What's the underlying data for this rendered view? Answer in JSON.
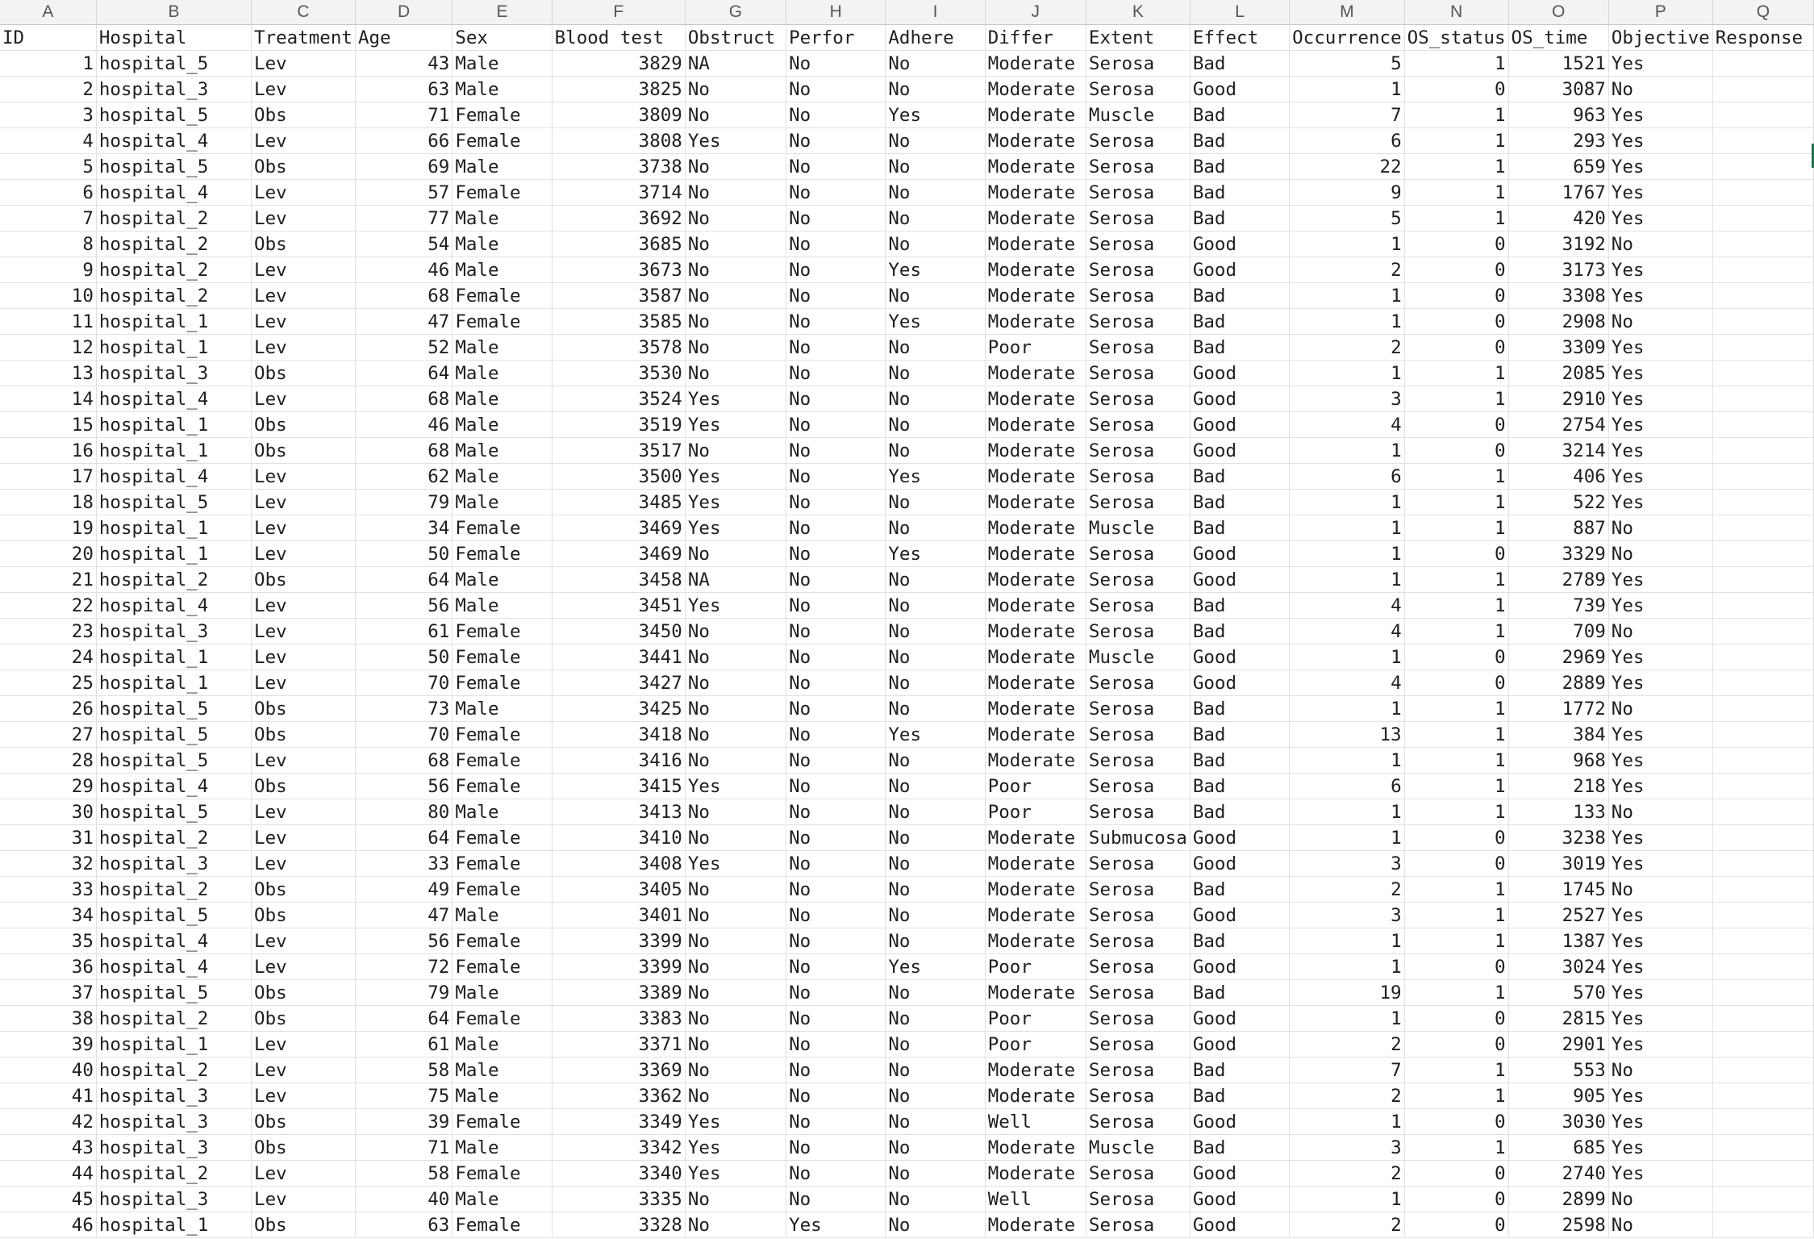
{
  "column_letters": [
    "A",
    "B",
    "C",
    "D",
    "E",
    "F",
    "G",
    "H",
    "I",
    "J",
    "K",
    "L",
    "M",
    "N",
    "O",
    "P",
    "Q"
  ],
  "header_row": [
    "ID",
    "Hospital",
    "Treatment",
    "Age",
    "Sex",
    "Blood test",
    "Obstruct",
    "Perfor",
    "Adhere",
    "Differ",
    "Extent",
    "Effect",
    "Occurrence",
    "OS_status",
    "OS_time",
    "Objective",
    "Response"
  ],
  "rows": [
    [
      "1",
      "hospital_5",
      "Lev",
      "43",
      "Male",
      "3829",
      "NA",
      "No",
      "No",
      "Moderate",
      "Serosa",
      "Bad",
      "5",
      "1",
      "1521",
      "Yes",
      ""
    ],
    [
      "2",
      "hospital_3",
      "Lev",
      "63",
      "Male",
      "3825",
      "No",
      "No",
      "No",
      "Moderate",
      "Serosa",
      "Good",
      "1",
      "0",
      "3087",
      "No",
      ""
    ],
    [
      "3",
      "hospital_5",
      "Obs",
      "71",
      "Female",
      "3809",
      "No",
      "No",
      "Yes",
      "Moderate",
      "Muscle",
      "Bad",
      "7",
      "1",
      "963",
      "Yes",
      ""
    ],
    [
      "4",
      "hospital_4",
      "Lev",
      "66",
      "Female",
      "3808",
      "Yes",
      "No",
      "No",
      "Moderate",
      "Serosa",
      "Bad",
      "6",
      "1",
      "293",
      "Yes",
      ""
    ],
    [
      "5",
      "hospital_5",
      "Obs",
      "69",
      "Male",
      "3738",
      "No",
      "No",
      "No",
      "Moderate",
      "Serosa",
      "Bad",
      "22",
      "1",
      "659",
      "Yes",
      ""
    ],
    [
      "6",
      "hospital_4",
      "Lev",
      "57",
      "Female",
      "3714",
      "No",
      "No",
      "No",
      "Moderate",
      "Serosa",
      "Bad",
      "9",
      "1",
      "1767",
      "Yes",
      ""
    ],
    [
      "7",
      "hospital_2",
      "Lev",
      "77",
      "Male",
      "3692",
      "No",
      "No",
      "No",
      "Moderate",
      "Serosa",
      "Bad",
      "5",
      "1",
      "420",
      "Yes",
      ""
    ],
    [
      "8",
      "hospital_2",
      "Obs",
      "54",
      "Male",
      "3685",
      "No",
      "No",
      "No",
      "Moderate",
      "Serosa",
      "Good",
      "1",
      "0",
      "3192",
      "No",
      ""
    ],
    [
      "9",
      "hospital_2",
      "Lev",
      "46",
      "Male",
      "3673",
      "No",
      "No",
      "Yes",
      "Moderate",
      "Serosa",
      "Good",
      "2",
      "0",
      "3173",
      "Yes",
      ""
    ],
    [
      "10",
      "hospital_2",
      "Lev",
      "68",
      "Female",
      "3587",
      "No",
      "No",
      "No",
      "Moderate",
      "Serosa",
      "Bad",
      "1",
      "0",
      "3308",
      "Yes",
      ""
    ],
    [
      "11",
      "hospital_1",
      "Lev",
      "47",
      "Female",
      "3585",
      "No",
      "No",
      "Yes",
      "Moderate",
      "Serosa",
      "Bad",
      "1",
      "0",
      "2908",
      "No",
      ""
    ],
    [
      "12",
      "hospital_1",
      "Lev",
      "52",
      "Male",
      "3578",
      "No",
      "No",
      "No",
      "Poor",
      "Serosa",
      "Bad",
      "2",
      "0",
      "3309",
      "Yes",
      ""
    ],
    [
      "13",
      "hospital_3",
      "Obs",
      "64",
      "Male",
      "3530",
      "No",
      "No",
      "No",
      "Moderate",
      "Serosa",
      "Good",
      "1",
      "1",
      "2085",
      "Yes",
      ""
    ],
    [
      "14",
      "hospital_4",
      "Lev",
      "68",
      "Male",
      "3524",
      "Yes",
      "No",
      "No",
      "Moderate",
      "Serosa",
      "Good",
      "3",
      "1",
      "2910",
      "Yes",
      ""
    ],
    [
      "15",
      "hospital_1",
      "Obs",
      "46",
      "Male",
      "3519",
      "Yes",
      "No",
      "No",
      "Moderate",
      "Serosa",
      "Good",
      "4",
      "0",
      "2754",
      "Yes",
      ""
    ],
    [
      "16",
      "hospital_1",
      "Obs",
      "68",
      "Male",
      "3517",
      "No",
      "No",
      "No",
      "Moderate",
      "Serosa",
      "Good",
      "1",
      "0",
      "3214",
      "Yes",
      ""
    ],
    [
      "17",
      "hospital_4",
      "Lev",
      "62",
      "Male",
      "3500",
      "Yes",
      "No",
      "Yes",
      "Moderate",
      "Serosa",
      "Bad",
      "6",
      "1",
      "406",
      "Yes",
      ""
    ],
    [
      "18",
      "hospital_5",
      "Lev",
      "79",
      "Male",
      "3485",
      "Yes",
      "No",
      "No",
      "Moderate",
      "Serosa",
      "Bad",
      "1",
      "1",
      "522",
      "Yes",
      ""
    ],
    [
      "19",
      "hospital_1",
      "Lev",
      "34",
      "Female",
      "3469",
      "Yes",
      "No",
      "No",
      "Moderate",
      "Muscle",
      "Bad",
      "1",
      "1",
      "887",
      "No",
      ""
    ],
    [
      "20",
      "hospital_1",
      "Lev",
      "50",
      "Female",
      "3469",
      "No",
      "No",
      "Yes",
      "Moderate",
      "Serosa",
      "Good",
      "1",
      "0",
      "3329",
      "No",
      ""
    ],
    [
      "21",
      "hospital_2",
      "Obs",
      "64",
      "Male",
      "3458",
      "NA",
      "No",
      "No",
      "Moderate",
      "Serosa",
      "Good",
      "1",
      "1",
      "2789",
      "Yes",
      ""
    ],
    [
      "22",
      "hospital_4",
      "Lev",
      "56",
      "Male",
      "3451",
      "Yes",
      "No",
      "No",
      "Moderate",
      "Serosa",
      "Bad",
      "4",
      "1",
      "739",
      "Yes",
      ""
    ],
    [
      "23",
      "hospital_3",
      "Lev",
      "61",
      "Female",
      "3450",
      "No",
      "No",
      "No",
      "Moderate",
      "Serosa",
      "Bad",
      "4",
      "1",
      "709",
      "No",
      ""
    ],
    [
      "24",
      "hospital_1",
      "Lev",
      "50",
      "Female",
      "3441",
      "No",
      "No",
      "No",
      "Moderate",
      "Muscle",
      "Good",
      "1",
      "0",
      "2969",
      "Yes",
      ""
    ],
    [
      "25",
      "hospital_1",
      "Lev",
      "70",
      "Female",
      "3427",
      "No",
      "No",
      "No",
      "Moderate",
      "Serosa",
      "Good",
      "4",
      "0",
      "2889",
      "Yes",
      ""
    ],
    [
      "26",
      "hospital_5",
      "Obs",
      "73",
      "Male",
      "3425",
      "No",
      "No",
      "No",
      "Moderate",
      "Serosa",
      "Bad",
      "1",
      "1",
      "1772",
      "No",
      ""
    ],
    [
      "27",
      "hospital_5",
      "Obs",
      "70",
      "Female",
      "3418",
      "No",
      "No",
      "Yes",
      "Moderate",
      "Serosa",
      "Bad",
      "13",
      "1",
      "384",
      "Yes",
      ""
    ],
    [
      "28",
      "hospital_5",
      "Lev",
      "68",
      "Female",
      "3416",
      "No",
      "No",
      "No",
      "Moderate",
      "Serosa",
      "Bad",
      "1",
      "1",
      "968",
      "Yes",
      ""
    ],
    [
      "29",
      "hospital_4",
      "Obs",
      "56",
      "Female",
      "3415",
      "Yes",
      "No",
      "No",
      "Poor",
      "Serosa",
      "Bad",
      "6",
      "1",
      "218",
      "Yes",
      ""
    ],
    [
      "30",
      "hospital_5",
      "Lev",
      "80",
      "Male",
      "3413",
      "No",
      "No",
      "No",
      "Poor",
      "Serosa",
      "Bad",
      "1",
      "1",
      "133",
      "No",
      ""
    ],
    [
      "31",
      "hospital_2",
      "Lev",
      "64",
      "Female",
      "3410",
      "No",
      "No",
      "No",
      "Moderate",
      "Submucosa",
      "Good",
      "1",
      "0",
      "3238",
      "Yes",
      ""
    ],
    [
      "32",
      "hospital_3",
      "Lev",
      "33",
      "Female",
      "3408",
      "Yes",
      "No",
      "No",
      "Moderate",
      "Serosa",
      "Good",
      "3",
      "0",
      "3019",
      "Yes",
      ""
    ],
    [
      "33",
      "hospital_2",
      "Obs",
      "49",
      "Female",
      "3405",
      "No",
      "No",
      "No",
      "Moderate",
      "Serosa",
      "Bad",
      "2",
      "1",
      "1745",
      "No",
      ""
    ],
    [
      "34",
      "hospital_5",
      "Obs",
      "47",
      "Male",
      "3401",
      "No",
      "No",
      "No",
      "Moderate",
      "Serosa",
      "Good",
      "3",
      "1",
      "2527",
      "Yes",
      ""
    ],
    [
      "35",
      "hospital_4",
      "Lev",
      "56",
      "Female",
      "3399",
      "No",
      "No",
      "No",
      "Moderate",
      "Serosa",
      "Bad",
      "1",
      "1",
      "1387",
      "Yes",
      ""
    ],
    [
      "36",
      "hospital_4",
      "Lev",
      "72",
      "Female",
      "3399",
      "No",
      "No",
      "Yes",
      "Poor",
      "Serosa",
      "Good",
      "1",
      "0",
      "3024",
      "Yes",
      ""
    ],
    [
      "37",
      "hospital_5",
      "Obs",
      "79",
      "Male",
      "3389",
      "No",
      "No",
      "No",
      "Moderate",
      "Serosa",
      "Bad",
      "19",
      "1",
      "570",
      "Yes",
      ""
    ],
    [
      "38",
      "hospital_2",
      "Obs",
      "64",
      "Female",
      "3383",
      "No",
      "No",
      "No",
      "Poor",
      "Serosa",
      "Good",
      "1",
      "0",
      "2815",
      "Yes",
      ""
    ],
    [
      "39",
      "hospital_1",
      "Lev",
      "61",
      "Male",
      "3371",
      "No",
      "No",
      "No",
      "Poor",
      "Serosa",
      "Good",
      "2",
      "0",
      "2901",
      "Yes",
      ""
    ],
    [
      "40",
      "hospital_2",
      "Lev",
      "58",
      "Male",
      "3369",
      "No",
      "No",
      "No",
      "Moderate",
      "Serosa",
      "Bad",
      "7",
      "1",
      "553",
      "No",
      ""
    ],
    [
      "41",
      "hospital_3",
      "Lev",
      "75",
      "Male",
      "3362",
      "No",
      "No",
      "No",
      "Moderate",
      "Serosa",
      "Bad",
      "2",
      "1",
      "905",
      "Yes",
      ""
    ],
    [
      "42",
      "hospital_3",
      "Obs",
      "39",
      "Female",
      "3349",
      "Yes",
      "No",
      "No",
      "Well",
      "Serosa",
      "Good",
      "1",
      "0",
      "3030",
      "Yes",
      ""
    ],
    [
      "43",
      "hospital_3",
      "Obs",
      "71",
      "Male",
      "3342",
      "Yes",
      "No",
      "No",
      "Moderate",
      "Muscle",
      "Bad",
      "3",
      "1",
      "685",
      "Yes",
      ""
    ],
    [
      "44",
      "hospital_2",
      "Lev",
      "58",
      "Female",
      "3340",
      "Yes",
      "No",
      "No",
      "Moderate",
      "Serosa",
      "Good",
      "2",
      "0",
      "2740",
      "Yes",
      ""
    ],
    [
      "45",
      "hospital_3",
      "Lev",
      "40",
      "Male",
      "3335",
      "No",
      "No",
      "No",
      "Well",
      "Serosa",
      "Good",
      "1",
      "0",
      "2899",
      "No",
      ""
    ],
    [
      "46",
      "hospital_1",
      "Obs",
      "63",
      "Female",
      "3328",
      "No",
      "Yes",
      "No",
      "Moderate",
      "Serosa",
      "Good",
      "2",
      "0",
      "2598",
      "No",
      ""
    ]
  ],
  "colors": {
    "header_bg": "#f3f3f3",
    "gridline": "#e1e1e1",
    "selection": "#217346"
  }
}
